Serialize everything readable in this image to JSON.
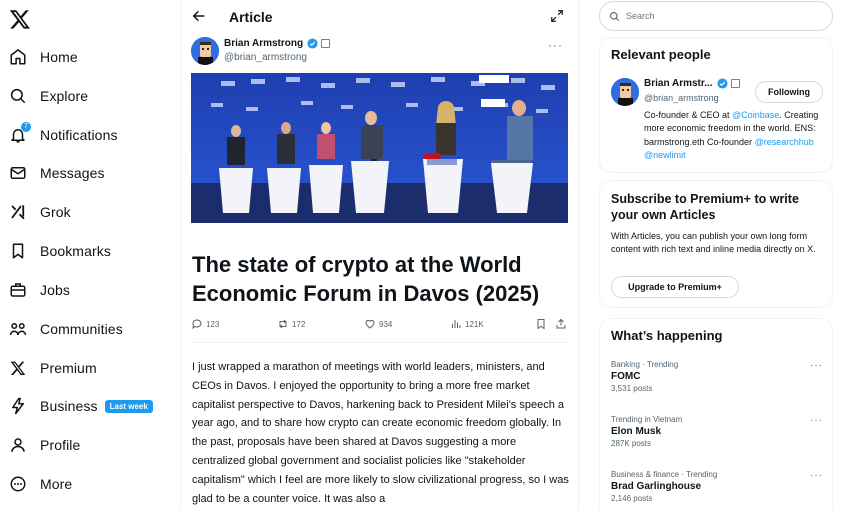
{
  "nav": {
    "items": [
      {
        "label": "Home",
        "icon": "home-icon"
      },
      {
        "label": "Explore",
        "icon": "search-icon"
      },
      {
        "label": "Notifications",
        "icon": "bell-icon",
        "badge": "7"
      },
      {
        "label": "Messages",
        "icon": "envelope-icon"
      },
      {
        "label": "Grok",
        "icon": "grok-icon"
      },
      {
        "label": "Bookmarks",
        "icon": "bookmark-icon"
      },
      {
        "label": "Jobs",
        "icon": "briefcase-icon"
      },
      {
        "label": "Communities",
        "icon": "people-icon"
      },
      {
        "label": "Premium",
        "icon": "x-logo-icon"
      },
      {
        "label": "Business",
        "icon": "lightning-icon",
        "pill": "Last week"
      },
      {
        "label": "Profile",
        "icon": "person-icon"
      },
      {
        "label": "More",
        "icon": "more-circle-icon"
      }
    ]
  },
  "header": {
    "title": "Article"
  },
  "post": {
    "author_name": "Brian Armstrong",
    "author_handle": "@brian_armstrong",
    "title": "The state of crypto at the World Economic Forum in Davos (2025)",
    "stats": {
      "replies": "123",
      "reposts": "172",
      "likes": "934",
      "views": "121K"
    },
    "body": "I just wrapped a marathon of meetings with world leaders, ministers, and CEOs in Davos. I enjoyed the opportunity to bring a more free market capitalist perspective to Davos, harkening back to President Milei's speech a year ago, and to share how crypto can create economic freedom globally. In the past, proposals have been shared at Davos suggesting a more centralized global government and socialist policies like \"stakeholder capitalism\" which I feel are more likely to slow civilizational progress, so I was glad to be a counter voice. It was also a"
  },
  "search": {
    "placeholder": "Search"
  },
  "relevant": {
    "title": "Relevant people",
    "name": "Brian Armstr...",
    "handle": "@brian_armstrong",
    "follow_label": "Following",
    "bio_1": "Co-founder & CEO at ",
    "bio_link1": "@Coinbase",
    "bio_2": ". Creating more economic freedom in the world. ENS: barmstrong.eth Co-founder ",
    "bio_link2": "@researchhub",
    "bio_link3": "@newlimit"
  },
  "premium": {
    "title": "Subscribe to Premium+ to write your own Articles",
    "text": "With Articles, you can publish your own long form content with rich text and inline media directly on X.",
    "button": "Upgrade to Premium+"
  },
  "trends": {
    "title": "What’s happening",
    "items": [
      {
        "meta": "Banking · Trending",
        "topic": "FOMC",
        "posts": "3,531 posts"
      },
      {
        "meta": "Trending in Vietnam",
        "topic": "Elon Musk",
        "posts": "287K posts"
      },
      {
        "meta": "Business & finance · Trending",
        "topic": "Brad Garlinghouse",
        "posts": "2,146 posts"
      }
    ]
  },
  "colors": {
    "accent": "#1d9bf0",
    "text": "#0f1419",
    "muted": "#536471",
    "border": "#eff3f4"
  }
}
